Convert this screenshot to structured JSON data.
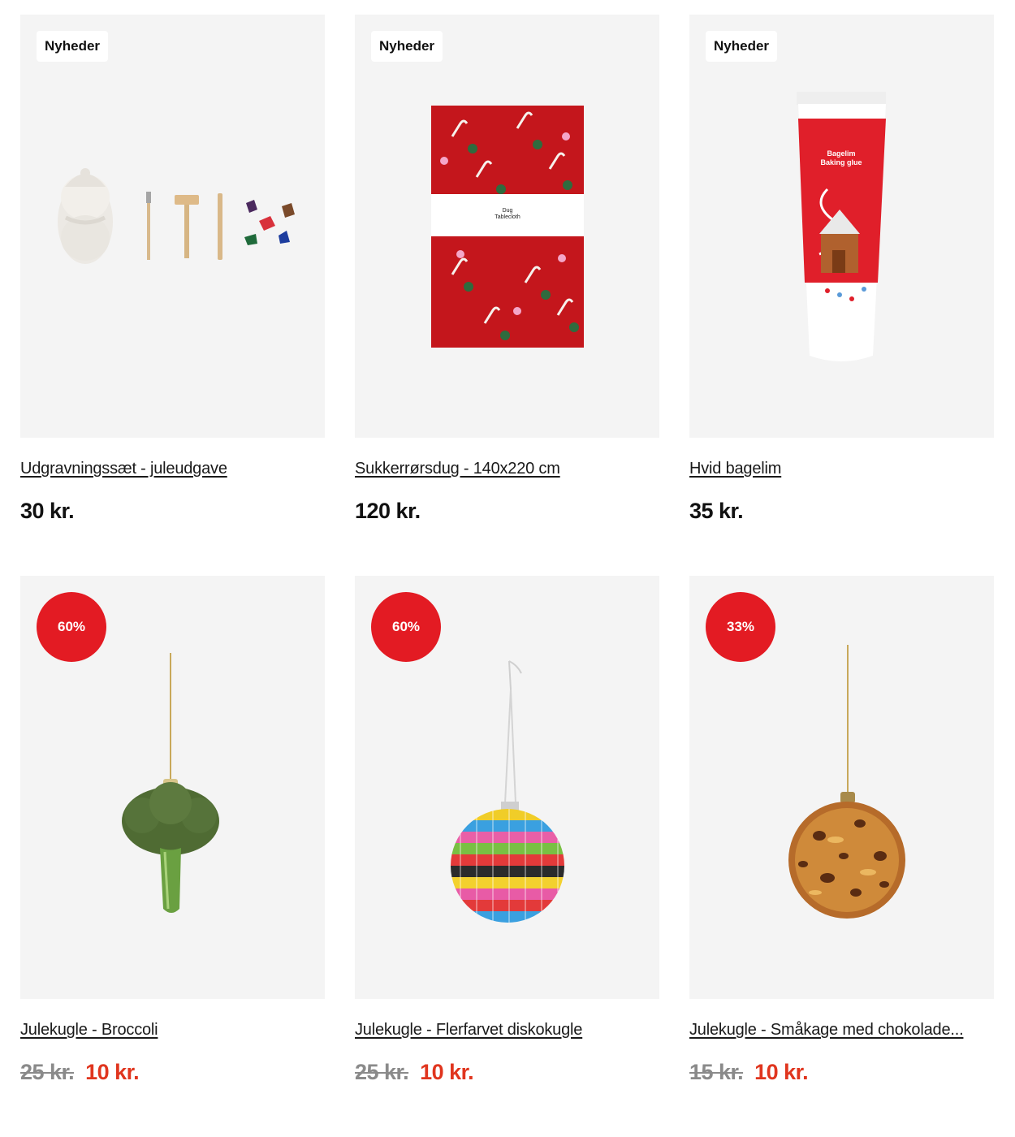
{
  "products": [
    {
      "badge": "Nyheder",
      "title": "Udgravningssæt - juleudgave",
      "price": "30 kr."
    },
    {
      "badge": "Nyheder",
      "title": "Sukkerrørsdug - 140x220 cm",
      "price": "120 kr.",
      "package_label": "Dug\nTablecloth"
    },
    {
      "badge": "Nyheder",
      "title": "Hvid bagelim",
      "price": "35 kr.",
      "tube_label": "Bagelim\nBaking glue"
    },
    {
      "discount": "60%",
      "title": "Julekugle - Broccoli",
      "old_price": "25 kr.",
      "new_price": "10 kr."
    },
    {
      "discount": "60%",
      "title": "Julekugle - Flerfarvet diskokugle",
      "old_price": "25 kr.",
      "new_price": "10 kr."
    },
    {
      "discount": "33%",
      "title": "Julekugle - Småkage med chokolade...",
      "old_price": "15 kr.",
      "new_price": "10 kr."
    }
  ],
  "colors": {
    "card_bg": "#f4f4f4",
    "discount_badge": "#e31b23",
    "sale_price": "#e0351e",
    "old_price": "#8a8a8a"
  }
}
